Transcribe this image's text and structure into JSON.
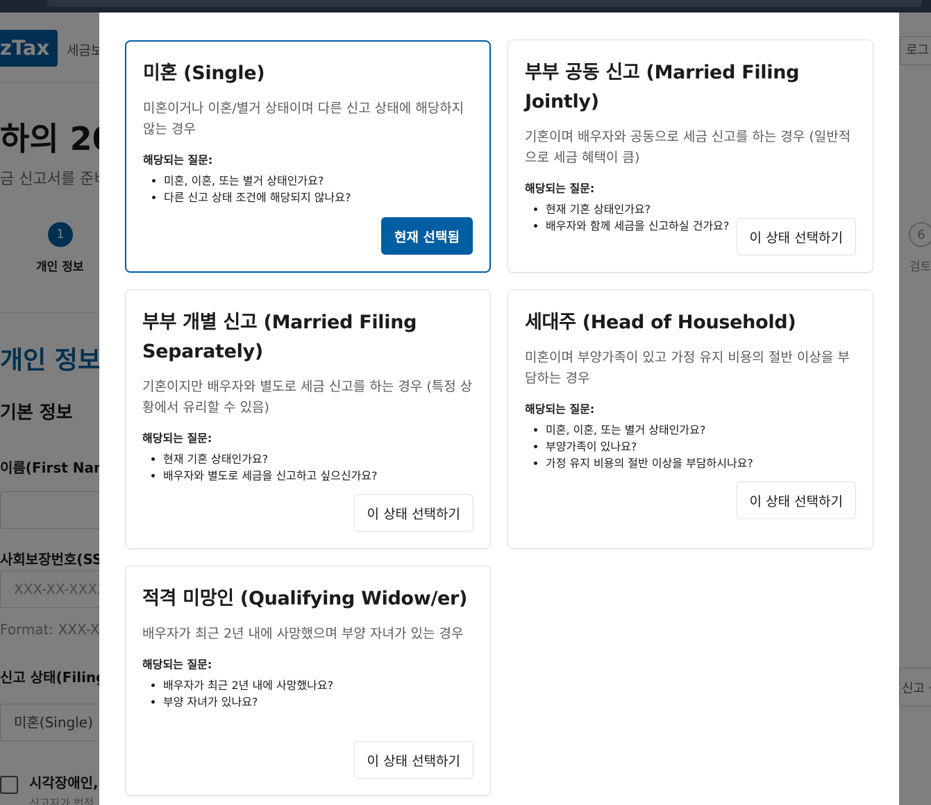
{
  "background": {
    "logo": "zTax",
    "nav_partial": "세금보",
    "login_partial": "로그",
    "title_partial": "하의 20",
    "subtitle_partial": "금 신고서를 준비",
    "step1_number": "1",
    "step1_label": "개인 정보",
    "step6_number": "6",
    "step6_label": "검토",
    "section_title_partial": "개인 정보",
    "subsection_title": "기본 정보",
    "first_name_label": "이름(First Nam",
    "ssn_label": "사회보장번호(SS",
    "ssn_placeholder": "XXX-XX-XXXX",
    "ssn_hint": "Format: XXX-XX",
    "filing_status_label": "신고 상태(Filing",
    "filing_status_value": "미혼(Single)",
    "right_label_partial": "신고 상",
    "checkbox_label": "시각장애인,",
    "checkbox_hint": "신고자가 법적"
  },
  "modal": {
    "cards": [
      {
        "title": "미혼 (Single)",
        "description": "미혼이거나 이혼/별거 상태이며 다른 신고 상태에 해당하지 않는 경우",
        "questions_title": "해당되는 질문:",
        "questions": [
          "미혼, 이혼, 또는 별거 상태인가요?",
          "다른 신고 상태 조건에 해당되지 않나요?"
        ],
        "button": "현재 선택됨",
        "selected": true
      },
      {
        "title": "부부 공동 신고 (Married Filing Jointly)",
        "description": "기혼이며 배우자와 공동으로 세금 신고를 하는 경우 (일반적으로 세금 혜택이 큼)",
        "questions_title": "해당되는 질문:",
        "questions": [
          "현재 기혼 상태인가요?",
          "배우자와 함께 세금을 신고하실 건가요?"
        ],
        "button": "이 상태 선택하기",
        "selected": false
      },
      {
        "title": "부부 개별 신고 (Married Filing Separately)",
        "description": "기혼이지만 배우자와 별도로 세금 신고를 하는 경우 (특정 상황에서 유리할 수 있음)",
        "questions_title": "해당되는 질문:",
        "questions": [
          "현재 기혼 상태인가요?",
          "배우자와 별도로 세금을 신고하고 싶으신가요?"
        ],
        "button": "이 상태 선택하기",
        "selected": false
      },
      {
        "title": "세대주 (Head of Household)",
        "description": "미혼이며 부양가족이 있고 가정 유지 비용의 절반 이상을 부담하는 경우",
        "questions_title": "해당되는 질문:",
        "questions": [
          "미혼, 이혼, 또는 별거 상태인가요?",
          "부양가족이 있나요?",
          "가정 유지 비용의 절반 이상을 부담하시나요?"
        ],
        "button": "이 상태 선택하기",
        "selected": false
      },
      {
        "title": "적격 미망인 (Qualifying Widow/er)",
        "description": "배우자가 최근 2년 내에 사망했으며 부양 자녀가 있는 경우",
        "questions_title": "해당되는 질문:",
        "questions": [
          "배우자가 최근 2년 내에 사망했나요?",
          "부양 자녀가 있나요?"
        ],
        "button": "이 상태 선택하기",
        "selected": false
      }
    ]
  },
  "colors": {
    "primary": "#005ea2",
    "border": "#dcdee0",
    "overlay": "rgba(0,0,0,0.5)"
  }
}
